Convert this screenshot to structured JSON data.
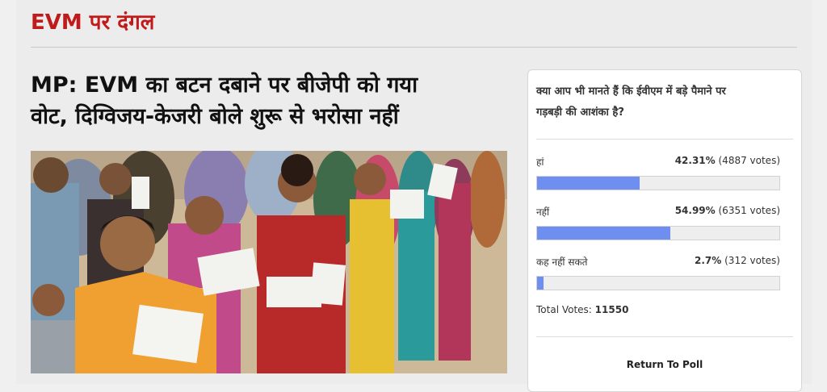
{
  "section": {
    "title": "EVM पर दंगल"
  },
  "article": {
    "headline_line1": "MP: EVM का बटन दबाने पर बीजेपी को गया",
    "headline_line2": "वोट, दिग्विजय-केजरी बोले शुरू से भरोसा नहीं"
  },
  "poll": {
    "question_line1": "क्या आप भी मानते हैं कि ईवीएम में बड़े पैमाने पर",
    "question_line2": "गड़बड़ी की आशंका है?",
    "options": [
      {
        "label": "हां",
        "percent": "42.31%",
        "votes": "(4887 votes)",
        "fraction": 0.4231
      },
      {
        "label": "नहीं",
        "percent": "54.99%",
        "votes": "(6351 votes)",
        "fraction": 0.5499
      },
      {
        "label": "कह नहीं सकते",
        "percent": "2.7%",
        "votes": "(312 votes)",
        "fraction": 0.027
      }
    ],
    "total_label": "Total Votes:",
    "total_value": "11550",
    "return_label": "Return To Poll",
    "bar_color": "#6e8ef0"
  },
  "colors": {
    "accent": "#c01a1a"
  }
}
